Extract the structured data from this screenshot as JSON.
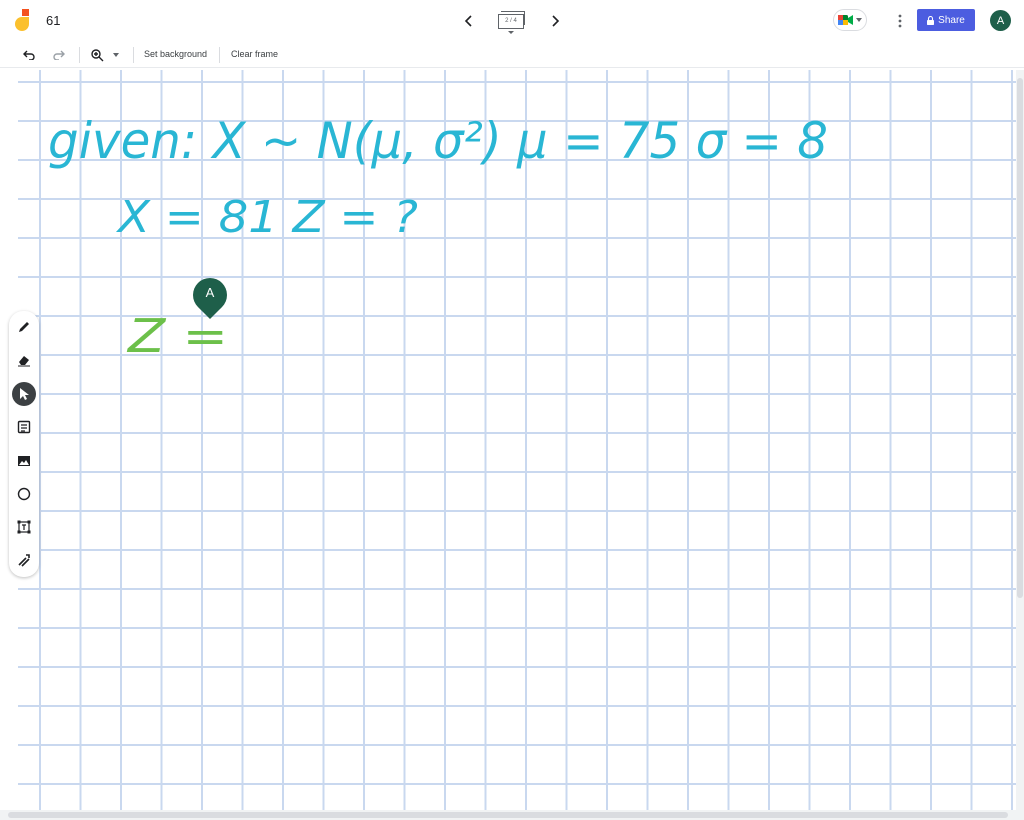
{
  "header": {
    "title": "61",
    "frame_indicator": "2 / 4",
    "share_label": "Share",
    "avatar_initial": "A"
  },
  "toolbar": {
    "set_background_label": "Set background",
    "clear_frame_label": "Clear frame"
  },
  "canvas": {
    "handwriting": {
      "line1": "given: X ~ N(μ, σ²)   μ = 75   σ = 8",
      "line2": "X = 81   Z = ?",
      "line3": "Z ="
    },
    "collaborator_cursor": "A"
  },
  "colors": {
    "share_button": "#4c5de0",
    "avatar": "#1e5f4a",
    "ink_cyan": "#29b6d4",
    "ink_green": "#6cc04a",
    "grid": "#c9d8ef"
  },
  "icons": {
    "logo": "jamboard-logo-icon",
    "prev": "chevron-left-icon",
    "next": "chevron-right-icon",
    "meet": "meet-video-icon",
    "more": "more-vert-icon",
    "lock": "lock-icon",
    "undo": "undo-icon",
    "redo": "redo-icon",
    "zoom": "zoom-in-icon",
    "pen": "pen-icon",
    "eraser": "eraser-icon",
    "select": "select-pointer-icon",
    "sticky": "sticky-note-icon",
    "image": "image-icon",
    "shape": "circle-shape-icon",
    "textbox": "text-box-icon",
    "laser": "laser-icon"
  }
}
